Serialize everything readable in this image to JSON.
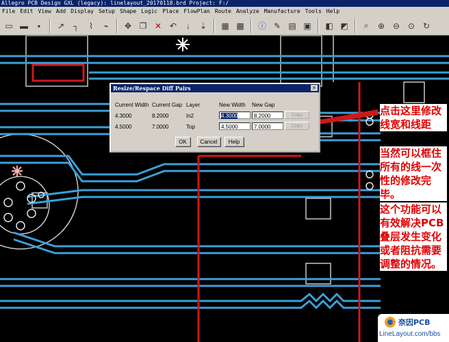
{
  "window": {
    "title": "Allegro PCB Design GXL (legacy): linelayout_20170118.brd  Project: F:/"
  },
  "menu": [
    "File",
    "Edit",
    "View",
    "Add",
    "Display",
    "Setup",
    "Shape",
    "Logic",
    "Place",
    "FlowPlan",
    "Route",
    "Analyze",
    "Manufacture",
    "Tools",
    "Help"
  ],
  "toolbar": {
    "icons": [
      "new-file-icon",
      "open-folder-icon",
      "save-icon",
      "add-connect-icon",
      "slide-icon",
      "delay-tune-icon",
      "custom-smooth-icon",
      "move-icon",
      "copy-icon",
      "delete-icon",
      "undo-icon",
      "redo-icon",
      "pin-swap-icon",
      "color-icon",
      "info-icon",
      "zoom-icon",
      "shape-icon",
      "grid-icon",
      "layer-icon",
      "zoom-fit-icon",
      "zoom-in-icon",
      "zoom-out-icon",
      "zoom-world-icon",
      "redraw-icon"
    ]
  },
  "dialog": {
    "title": "Resize/Respace Diff Pairs",
    "close": "×",
    "headers": {
      "current_width": "Current Width",
      "current_gap": "Current Gap",
      "layer": "Layer",
      "new_width": "New Width",
      "new_gap": "New Gap"
    },
    "rows": [
      {
        "current_width": "4.3000",
        "current_gap": "8.2000",
        "layer": "In2",
        "new_width": "4.3000",
        "new_gap": "8.2000",
        "copy": "Copy"
      },
      {
        "current_width": "4.5000",
        "current_gap": "7.0000",
        "layer": "Top",
        "new_width": "4.5000",
        "new_gap": "7.0000",
        "copy": "Copy"
      }
    ],
    "buttons": {
      "ok": "OK",
      "cancel": "Cancel",
      "help": "Help"
    }
  },
  "annotations": {
    "note1": "点击这里修改线宽和线距",
    "note2": "当然可以框住所有的线一次性的修改完毕。",
    "note3": "这个功能可以有效解决PCB叠层发生变化或者阻抗需要调整的情况。"
  },
  "watermark": {
    "name": "奈因PCB",
    "url": "LineLayout.com/bbs"
  },
  "colors": {
    "trace_blue": "#3aa0d8",
    "trace_red": "#d01818",
    "outline_gray": "#c8c8c8",
    "annotation_red": "#e00000",
    "titlebar": "#0a246a"
  }
}
